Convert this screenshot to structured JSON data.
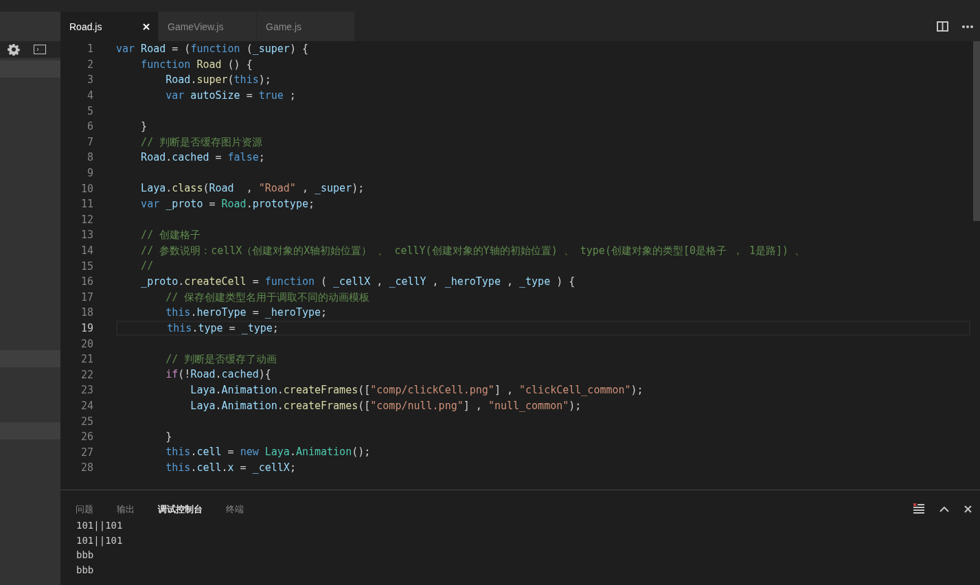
{
  "editor_tabs": [
    {
      "label": "Road.js",
      "selected": true
    },
    {
      "label": "GameView.js",
      "selected": false
    },
    {
      "label": "Game.js",
      "selected": false
    }
  ],
  "code_lines": [
    {
      "number": "1",
      "current": false,
      "tokens": [
        {
          "kind": "kw",
          "text": "var"
        },
        {
          "kind": "id",
          "text": " Road"
        },
        {
          "kind": "p",
          "text": " = ("
        },
        {
          "kind": "kw",
          "text": "function"
        },
        {
          "kind": "p",
          "text": " ("
        },
        {
          "kind": "id",
          "text": "_super"
        },
        {
          "kind": "p",
          "text": ") {"
        }
      ]
    },
    {
      "number": "2",
      "current": false,
      "tokens": [
        {
          "kind": "kw",
          "text": "    function"
        },
        {
          "kind": "fn",
          "text": " Road"
        },
        {
          "kind": "p",
          "text": " () {"
        }
      ]
    },
    {
      "number": "3",
      "current": false,
      "tokens": [
        {
          "kind": "id",
          "text": "        Road"
        },
        {
          "kind": "p",
          "text": "."
        },
        {
          "kind": "fn",
          "text": "super"
        },
        {
          "kind": "p",
          "text": "("
        },
        {
          "kind": "kw",
          "text": "this"
        },
        {
          "kind": "p",
          "text": ");"
        }
      ]
    },
    {
      "number": "4",
      "current": false,
      "tokens": [
        {
          "kind": "kw",
          "text": "        var"
        },
        {
          "kind": "id",
          "text": " autoSize"
        },
        {
          "kind": "p",
          "text": " = "
        },
        {
          "kind": "kw",
          "text": "true"
        },
        {
          "kind": "p",
          "text": " ;"
        }
      ]
    },
    {
      "number": "5",
      "current": false
    },
    {
      "number": "6",
      "current": false,
      "tokens": [
        {
          "kind": "p",
          "text": "    }"
        }
      ]
    },
    {
      "number": "7",
      "current": false,
      "tokens": [
        {
          "kind": "com",
          "text": "    // 判断是否缓存图片资源"
        }
      ]
    },
    {
      "number": "8",
      "current": false,
      "tokens": [
        {
          "kind": "id",
          "text": "    Road"
        },
        {
          "kind": "p",
          "text": "."
        },
        {
          "kind": "id",
          "text": "cached"
        },
        {
          "kind": "p",
          "text": " = "
        },
        {
          "kind": "kw",
          "text": "false"
        },
        {
          "kind": "p",
          "text": ";"
        }
      ]
    },
    {
      "number": "9",
      "current": false
    },
    {
      "number": "10",
      "current": false,
      "tokens": [
        {
          "kind": "id",
          "text": "    Laya"
        },
        {
          "kind": "p",
          "text": "."
        },
        {
          "kind": "fn",
          "text": "class"
        },
        {
          "kind": "p",
          "text": "("
        },
        {
          "kind": "id",
          "text": "Road"
        },
        {
          "kind": "p",
          "text": "  , "
        },
        {
          "kind": "str",
          "text": "\"Road\""
        },
        {
          "kind": "p",
          "text": " , "
        },
        {
          "kind": "id",
          "text": "_super"
        },
        {
          "kind": "p",
          "text": ");"
        }
      ]
    },
    {
      "number": "11",
      "current": false,
      "tokens": [
        {
          "kind": "kw",
          "text": "    var"
        },
        {
          "kind": "id",
          "text": " _proto"
        },
        {
          "kind": "p",
          "text": " = "
        },
        {
          "kind": "cls",
          "text": "Road"
        },
        {
          "kind": "p",
          "text": "."
        },
        {
          "kind": "id",
          "text": "prototype"
        },
        {
          "kind": "p",
          "text": ";"
        }
      ]
    },
    {
      "number": "12",
      "current": false
    },
    {
      "number": "13",
      "current": false,
      "tokens": [
        {
          "kind": "com",
          "text": "    // 创建格子"
        }
      ]
    },
    {
      "number": "14",
      "current": false,
      "tokens": [
        {
          "kind": "com",
          "text": "    // 参数说明：cellX（创建对象的X轴初始位置） 、 cellY(创建对象的Y轴的初始位置) 、 type(创建对象的类型[0是格子 ， 1是路]) 、"
        }
      ]
    },
    {
      "number": "15",
      "current": false,
      "tokens": [
        {
          "kind": "com",
          "text": "    //"
        }
      ]
    },
    {
      "number": "16",
      "current": false,
      "tokens": [
        {
          "kind": "id",
          "text": "    _proto"
        },
        {
          "kind": "p",
          "text": "."
        },
        {
          "kind": "fn",
          "text": "createCell"
        },
        {
          "kind": "p",
          "text": " = "
        },
        {
          "kind": "kw",
          "text": "function"
        },
        {
          "kind": "p",
          "text": " ( "
        },
        {
          "kind": "id",
          "text": "_cellX"
        },
        {
          "kind": "p",
          "text": " , "
        },
        {
          "kind": "id",
          "text": "_cellY"
        },
        {
          "kind": "p",
          "text": " , "
        },
        {
          "kind": "id",
          "text": "_heroType"
        },
        {
          "kind": "p",
          "text": " , "
        },
        {
          "kind": "id",
          "text": "_type"
        },
        {
          "kind": "p",
          "text": " ) {"
        }
      ]
    },
    {
      "number": "17",
      "current": false,
      "tokens": [
        {
          "kind": "com",
          "text": "        // 保存创建类型名用于调取不同的动画模板"
        }
      ]
    },
    {
      "number": "18",
      "current": false,
      "tokens": [
        {
          "kind": "kw",
          "text": "        this"
        },
        {
          "kind": "p",
          "text": "."
        },
        {
          "kind": "id",
          "text": "heroType"
        },
        {
          "kind": "p",
          "text": " = "
        },
        {
          "kind": "id",
          "text": "_heroType"
        },
        {
          "kind": "p",
          "text": ";"
        }
      ]
    },
    {
      "number": "19",
      "current": true,
      "tokens": [
        {
          "kind": "kw",
          "text": "        this"
        },
        {
          "kind": "p",
          "text": "."
        },
        {
          "kind": "id",
          "text": "type"
        },
        {
          "kind": "p",
          "text": " = "
        },
        {
          "kind": "id",
          "text": "_type"
        },
        {
          "kind": "p",
          "text": ";"
        }
      ]
    },
    {
      "number": "20",
      "current": false
    },
    {
      "number": "21",
      "current": false,
      "tokens": [
        {
          "kind": "com",
          "text": "        // 判断是否缓存了动画"
        }
      ]
    },
    {
      "number": "22",
      "current": false,
      "tokens": [
        {
          "kind": "ctl",
          "text": "        if"
        },
        {
          "kind": "p",
          "text": "(!"
        },
        {
          "kind": "id",
          "text": "Road"
        },
        {
          "kind": "p",
          "text": "."
        },
        {
          "kind": "id",
          "text": "cached"
        },
        {
          "kind": "p",
          "text": "){"
        }
      ]
    },
    {
      "number": "23",
      "current": false,
      "tokens": [
        {
          "kind": "id",
          "text": "            Laya"
        },
        {
          "kind": "p",
          "text": "."
        },
        {
          "kind": "id",
          "text": "Animation"
        },
        {
          "kind": "p",
          "text": "."
        },
        {
          "kind": "fn",
          "text": "createFrames"
        },
        {
          "kind": "p",
          "text": "(["
        },
        {
          "kind": "str",
          "text": "\"comp/clickCell.png\""
        },
        {
          "kind": "p",
          "text": "] , "
        },
        {
          "kind": "str",
          "text": "\"clickCell_common\""
        },
        {
          "kind": "p",
          "text": ");"
        }
      ]
    },
    {
      "number": "24",
      "current": false,
      "tokens": [
        {
          "kind": "id",
          "text": "            Laya"
        },
        {
          "kind": "p",
          "text": "."
        },
        {
          "kind": "id",
          "text": "Animation"
        },
        {
          "kind": "p",
          "text": "."
        },
        {
          "kind": "fn",
          "text": "createFrames"
        },
        {
          "kind": "p",
          "text": "(["
        },
        {
          "kind": "str",
          "text": "\"comp/null.png\""
        },
        {
          "kind": "p",
          "text": "] , "
        },
        {
          "kind": "str",
          "text": "\"null_common\""
        },
        {
          "kind": "p",
          "text": ");"
        }
      ]
    },
    {
      "number": "25",
      "current": false
    },
    {
      "number": "26",
      "current": false,
      "tokens": [
        {
          "kind": "p",
          "text": "        }"
        }
      ]
    },
    {
      "number": "27",
      "current": false,
      "tokens": [
        {
          "kind": "kw",
          "text": "        this"
        },
        {
          "kind": "p",
          "text": "."
        },
        {
          "kind": "id",
          "text": "cell"
        },
        {
          "kind": "p",
          "text": " = "
        },
        {
          "kind": "kw",
          "text": "new"
        },
        {
          "kind": "cls",
          "text": " Laya"
        },
        {
          "kind": "p",
          "text": "."
        },
        {
          "kind": "cls",
          "text": "Animation"
        },
        {
          "kind": "p",
          "text": "();"
        }
      ]
    },
    {
      "number": "28",
      "current": false,
      "tokens": [
        {
          "kind": "kw",
          "text": "        this"
        },
        {
          "kind": "p",
          "text": "."
        },
        {
          "kind": "id",
          "text": "cell"
        },
        {
          "kind": "p",
          "text": "."
        },
        {
          "kind": "id",
          "text": "x"
        },
        {
          "kind": "p",
          "text": " = "
        },
        {
          "kind": "id",
          "text": "_cellX"
        },
        {
          "kind": "p",
          "text": ";"
        }
      ]
    }
  ],
  "panel_tabs": [
    {
      "label": "问题",
      "selected": false
    },
    {
      "label": "输出",
      "selected": false
    },
    {
      "label": "调试控制台",
      "selected": true
    },
    {
      "label": "终端",
      "selected": false
    }
  ],
  "console_output": [
    "101||101",
    "101||101",
    "bbb",
    "bbb"
  ]
}
